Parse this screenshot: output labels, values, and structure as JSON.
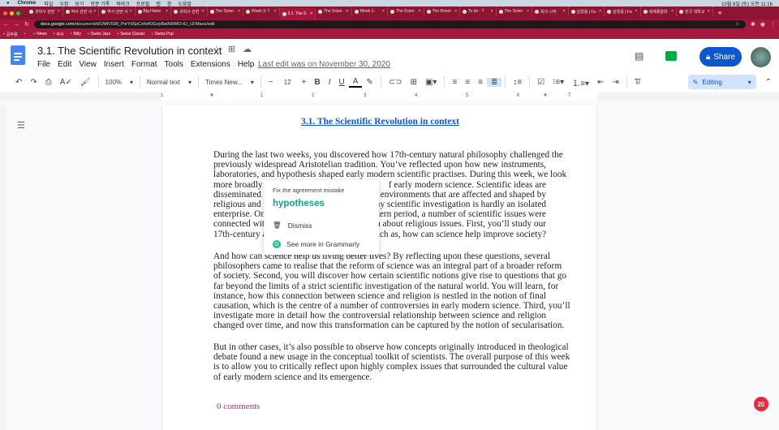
{
  "os_bar": {
    "app": "Chrome",
    "menus": [
      "파일",
      "수정",
      "보기",
      "방문 기록",
      "북마크",
      "프로필",
      "탭",
      "창",
      "도움말"
    ],
    "clock": "10월 8일 (토) 오전 11:16"
  },
  "tabs": [
    {
      "label": "과학사 관련"
    },
    {
      "label": "역사 관련 서"
    },
    {
      "label": "역사 관련 서"
    },
    {
      "label": "Big Histor"
    },
    {
      "label": "과학사 관련"
    },
    {
      "label": "The Scien"
    },
    {
      "label": "Week 3: T"
    },
    {
      "label": "3.1. The S",
      "active": true
    },
    {
      "label": "The Scien"
    },
    {
      "label": "Week 1: "
    },
    {
      "label": "The Scien"
    },
    {
      "label": "The Room"
    },
    {
      "label": "To do - T"
    },
    {
      "label": "The Scien"
    },
    {
      "label": "회의 시작"
    },
    {
      "label": "김형률 | Fa"
    },
    {
      "label": "김형률 | Fa"
    },
    {
      "label": "세계종합대"
    },
    {
      "label": "한국 대학교"
    }
  ],
  "address": {
    "host": "docs.google.com",
    "path": "/document/d/1NfiV598_PwYdSpCefwfOGvpBatNRMO-tU_rZrMaxs/edit"
  },
  "bookmarks": [
    "공부용",
    "",
    "News",
    "자식",
    "Bitly",
    "Swiss Jazz",
    "Swiss Classic",
    "Swiss Pop"
  ],
  "doc": {
    "title": "3.1. The Scientific Revolution in context",
    "menus": [
      "File",
      "Edit",
      "View",
      "Insert",
      "Format",
      "Tools",
      "Extensions",
      "Help"
    ],
    "last_edit": "Last edit was on November 30, 2020",
    "share": "Share"
  },
  "toolbar": {
    "zoom": "100%",
    "style": "Normal text",
    "font": "Times New...",
    "font_size": "12",
    "mode": "Editing"
  },
  "ruler": [
    "1",
    "1",
    "2",
    "3",
    "4",
    "5",
    "6",
    "7"
  ],
  "content": {
    "heading": "3.1. The Scientific Revolution in context",
    "p1": [
      "During the last two weeks, you discovered how 17th-century natural philosophy challenged the",
      "previously widespread Aristotelian tradition. You’ve reflected upon how new instruments,",
      "laboratories, and hypothesis shaped early modern scientific practises. During this week, we look",
      [
        "more broadly",
        "f early modern science. Scientific ideas are"
      ],
      [
        "disseminated a",
        "environments that are affected and shaped by"
      ],
      [
        "religious and p",
        "any scientific investigation is hardly an isolated"
      ],
      [
        "enterprise. On",
        "dern period, a number of scientific issues were"
      ],
      [
        "connected with",
        "n about religious issues. First, you’ll study our"
      ],
      [
        "17th-century a",
        "uch as, how can science help improve society?"
      ]
    ],
    "p2": [
      "And how can science help us living better lives? By reflecting upon these questions, several",
      "philosophers came to realise that the reform of science was an integral part of a broader reform",
      "of society. Second, you will discover how certain scientific notions give rise to questions that go",
      "far beyond the limits of a strict scientific investigation of the natural world. You will learn, for",
      "instance, how this connection between science and religion is nestled in the notion of final",
      "causation, which is the centre of a number of controversies in early modern science. Third, you’ll",
      "investigate more in detail how the controversial relationship between science and religion",
      "changed over time, and now this transformation can be captured by the notion of secularisation."
    ],
    "p3": [
      "But in other cases, it’s also possible to observe how concepts originally introduced in theological",
      "debate found a new usage in the conceptual toolkit of scientists. The overall purpose of this week",
      "is to allow you to critically reflect upon highly complex issues that surrounded the cultural value",
      "of early modern science and its emergence."
    ],
    "comments": "0 comments"
  },
  "grammarly": {
    "header": "Fix the agreement mistake",
    "suggestion": "hypotheses",
    "dismiss": "Dismiss",
    "more": "See more in Grammarly",
    "badge": "20",
    "color": "#15a38a"
  }
}
